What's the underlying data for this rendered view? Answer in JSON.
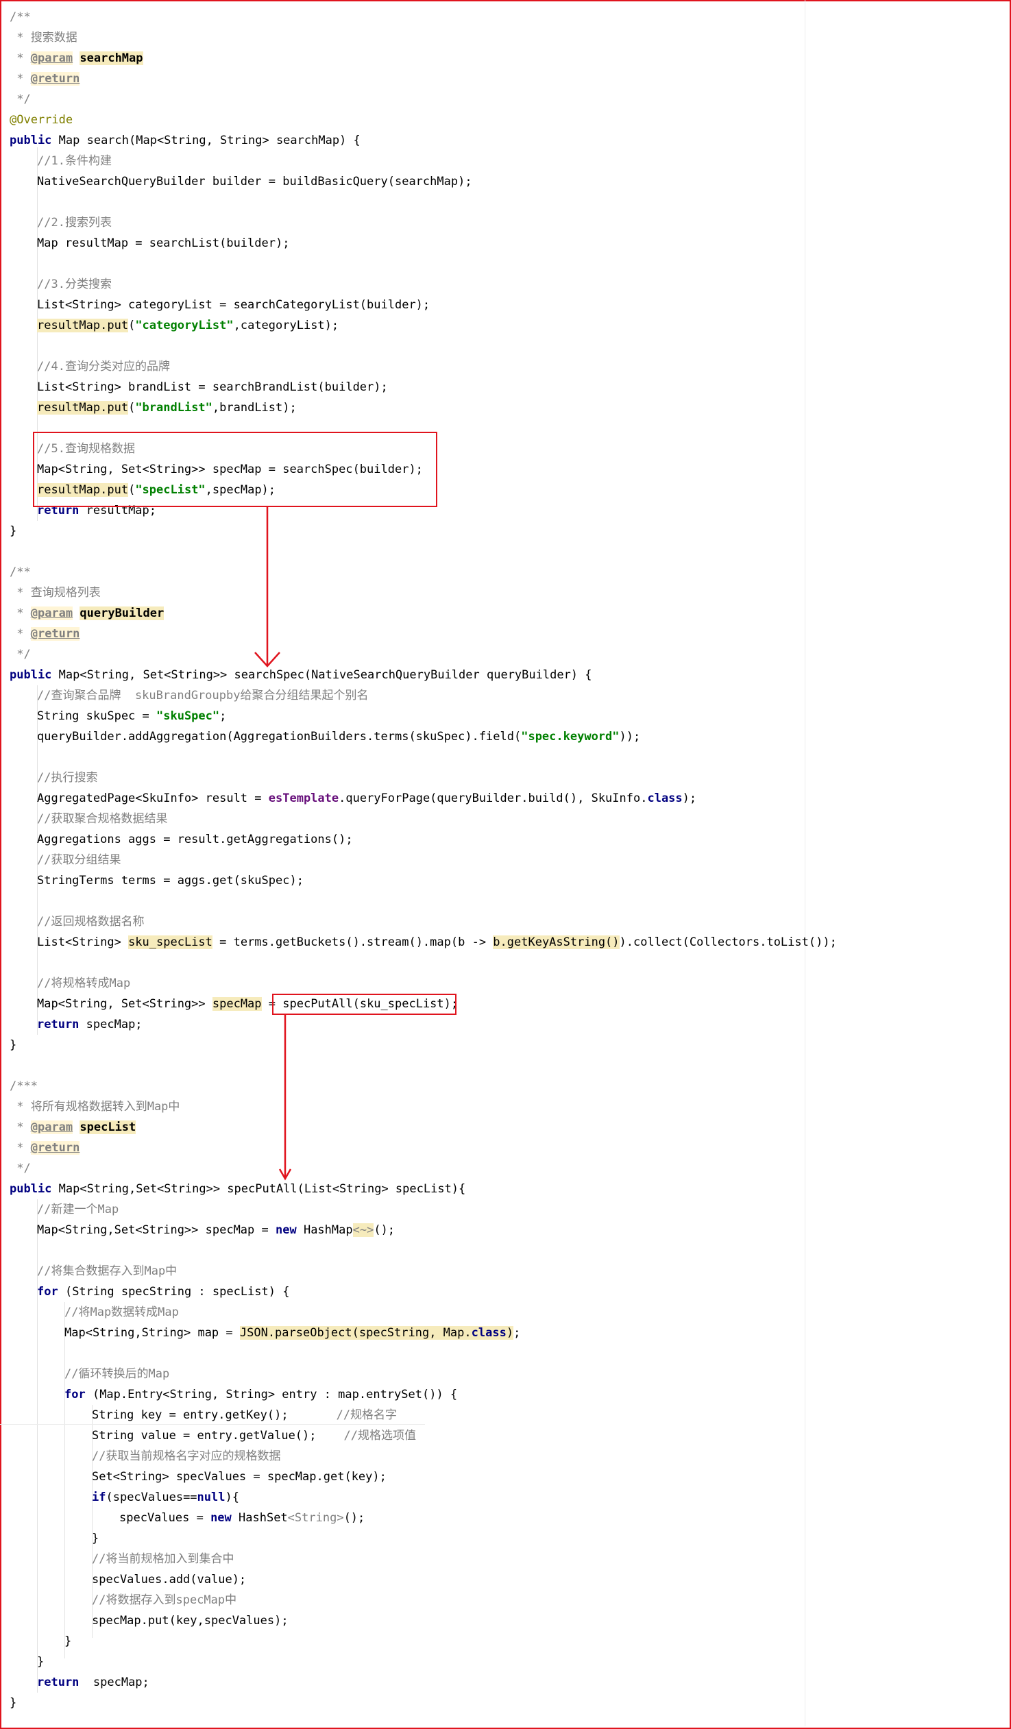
{
  "colors": {
    "frame": "#e0141e",
    "comment": "#808080",
    "keyword": "#000080",
    "string": "#008000",
    "annotation": "#808000",
    "field": "#660e7a",
    "highlight": "#f6ebbc"
  },
  "code": {
    "search_doc": {
      "open": "/**",
      "desc": " * 搜索数据",
      "param_star": " * ",
      "param_tag": "@param",
      "param_name": "searchMap",
      "return_star": " * ",
      "return_tag": "@return",
      "close": " */"
    },
    "override": "@Override",
    "search_sig": {
      "kw": "public",
      "rest": " Map search(Map<String, String> searchMap) {"
    },
    "c1": "//1.条件构建",
    "l_builder": "NativeSearchQueryBuilder builder = buildBasicQuery(searchMap);",
    "c2": "//2.搜索列表",
    "l_resultmap": "Map resultMap = searchList(builder);",
    "c3": "//3.分类搜索",
    "l_catlist": "List<String> categoryList = searchCategoryList(builder);",
    "put_cat": {
      "call": "resultMap.put",
      "open": "(",
      "str": "\"categoryList\"",
      "rest": ",categoryList);"
    },
    "c4": "//4.查询分类对应的品牌",
    "l_brandlist": "List<String> brandList = searchBrandList(builder);",
    "put_brand": {
      "call": "resultMap.put",
      "open": "(",
      "str": "\"brandList\"",
      "rest": ",brandList);"
    },
    "c5": "//5.查询规格数据",
    "l_specmap": "Map<String, Set<String>> specMap = searchSpec(builder);",
    "put_spec": {
      "call": "resultMap.put",
      "open": "(",
      "str": "\"specList\"",
      "rest": ",specMap);"
    },
    "ret1": {
      "kw": "return",
      "rest": " resultMap;"
    },
    "brace": "}",
    "spec_doc": {
      "open": "/**",
      "desc": " * 查询规格列表",
      "param_star": " * ",
      "param_tag": "@param",
      "param_name": "queryBuilder",
      "return_star": " * ",
      "return_tag": "@return",
      "close": " */"
    },
    "spec_sig": {
      "kw": "public",
      "rest": " Map<String, Set<String>> searchSpec(NativeSearchQueryBuilder queryBuilder) {"
    },
    "c_agg": "//查询聚合品牌  skuBrandGroupby给聚合分组结果起个别名",
    "l_skuspec": {
      "pre": "String skuSpec = ",
      "str": "\"skuSpec\"",
      "post": ";"
    },
    "l_addagg": {
      "pre": "queryBuilder.addAggregation(AggregationBuilders.terms(skuSpec).field(",
      "str": "\"spec.keyword\"",
      "post": "));"
    },
    "c_exec": "//执行搜索",
    "l_result": {
      "pre": "AggregatedPage<SkuInfo> result = ",
      "fld": "esTemplate",
      "mid": ".queryForPage(queryBuilder.build(), SkuInfo.",
      "kw": "class",
      "post": ");"
    },
    "c_getagg": "//获取聚合规格数据结果",
    "l_aggs": "Aggregations aggs = result.getAggregations();",
    "c_group": "//获取分组结果",
    "l_terms": "StringTerms terms = aggs.get(skuSpec);",
    "c_names": "//返回规格数据名称",
    "l_skulist": {
      "pre": "List<String> ",
      "hl1": "sku_specList",
      "mid": " = terms.getBuckets().stream().map(b -> ",
      "hl2": "b.getKeyAsString()",
      "post": ").collect(Collectors.toList());"
    },
    "c_tomap": "//将规格转成Map",
    "l_putall": {
      "pre": "Map<String, Set<String>> ",
      "hl": "specMap",
      "mid": " = ",
      "post": "specPutAll(sku_specList);"
    },
    "ret2": {
      "kw": "return",
      "rest": " specMap;"
    },
    "putall_doc": {
      "open": "/***",
      "desc": " * 将所有规格数据转入到Map中",
      "param_star": " * ",
      "param_tag": "@param",
      "param_name": "specList",
      "return_star": " * ",
      "return_tag": "@return",
      "close": " */"
    },
    "putall_sig": {
      "kw": "public",
      "rest": " Map<String,Set<String>> specPutAll(List<String> specList){"
    },
    "c_newmap": "//新建一个Map",
    "l_newmap": {
      "pre": "Map<String,Set<String>> specMap = ",
      "kw": "new",
      "mid": " HashMap",
      "hl": "<~>",
      "post": "();"
    },
    "c_store": "//将集合数据存入到Map中",
    "l_for1": {
      "kw": "for",
      "rest": " (String specString : specList) {"
    },
    "c_tomap2": "//将Map数据转成Map",
    "l_parse": {
      "pre": "Map<String,String> map = ",
      "hl_a": "JSON.parseObject(specString, Map.",
      "kw": "class",
      "hl_b": ")",
      "post": ";"
    },
    "c_loop": "//循环转换后的Map",
    "l_for2": {
      "kw": "for",
      "rest": " (Map.Entry<String, String> entry : map.entrySet()) {"
    },
    "l_key": {
      "code": "String key = entry.getKey();",
      "cm": "//规格名字"
    },
    "l_value": {
      "code": "String value = entry.getValue();",
      "cm": "//规格选项值"
    },
    "c_cur": "//获取当前规格名字对应的规格数据",
    "l_specvalues": "Set<String> specValues = specMap.get(key);",
    "l_if": {
      "kw": "if",
      "mid": "(specValues==",
      "kw2": "null",
      "post": "){"
    },
    "l_newset": {
      "pre": "specValues = ",
      "kw": "new",
      "mid": " HashSet",
      "gen": "<String>",
      "post": "();"
    },
    "c_add": "//将当前规格加入到集合中",
    "l_add": "specValues.add(value);",
    "c_put": "//将数据存入到specMap中",
    "l_put": "specMap.put(key,specValues);",
    "ret3": {
      "kw": "return",
      "rest": "  specMap;"
    }
  }
}
